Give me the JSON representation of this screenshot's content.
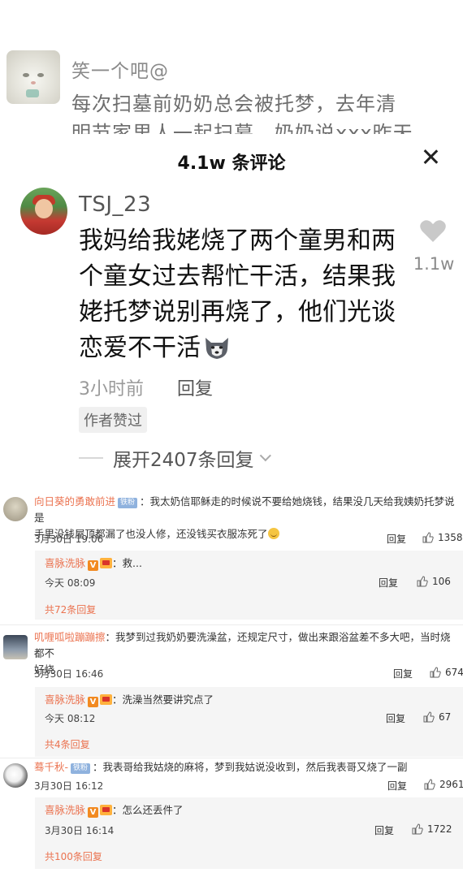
{
  "previous_comment": {
    "author": "笑一个吧@",
    "line1": "每次扫墓前奶奶总会被托梦，去年清",
    "line2": "明节家里人一起扫墓，奶奶说xxx昨天"
  },
  "panel": {
    "title": "4.1w 条评论",
    "comment": {
      "author": "TSJ_23",
      "lines": [
        "我妈给我姥烧了两个童男和两",
        "个童女过去帮忙干活，结果我",
        "姥托梦说别再烧了，他们光谈",
        "恋爱不干活"
      ],
      "emoji": "husky-icon",
      "likes": "1.1w",
      "time": "3小时前",
      "reply_label": "回复",
      "author_liked": "作者赞过",
      "expand_label": "展开2407条回复"
    }
  },
  "weibo": {
    "reply_label": "回复",
    "comments": [
      {
        "name": "向日葵的勇敢前进",
        "badge": "铁粉",
        "text_line1": "：我太奶信耶稣走的时候说不要给她烧钱，结果没几天给我姨奶托梦说是",
        "text_line2": "手里没钱屋顶都漏了也没人修，还没钱买衣服冻死了",
        "time": "3月30日 19:06",
        "likes": "1358",
        "reply": {
          "name": "喜脉洗脉",
          "text": "：救...",
          "time": "今天 08:09",
          "likes": "106"
        },
        "more": "共72条回复"
      },
      {
        "name": "叽喱呱啦蹦蹦擦",
        "badge": "",
        "text_line1": "：我梦到过我奶奶要洗澡盆，还规定尺寸，做出来跟浴盆差不多大吧，当时烧都不",
        "text_line2": "好烧",
        "time": "3月30日 16:46",
        "likes": "674",
        "reply": {
          "name": "喜脉洗脉",
          "text": "：洗澡当然要讲究点了",
          "time": "今天 08:12",
          "likes": "67"
        },
        "more": "共4条回复"
      },
      {
        "name": "蓦千秋-",
        "badge": "铁粉",
        "text_line1": "：我表哥给我姑烧的麻将，梦到我姑说没收到，然后我表哥又烧了一副",
        "text_line2": "",
        "time": "3月30日 16:12",
        "likes": "2961",
        "reply": {
          "name": "喜脉洗脉",
          "text": "：怎么还丢件了",
          "time": "3月30日 16:14",
          "likes": "1722"
        },
        "more": "共100条回复"
      }
    ]
  },
  "colors": {
    "accent": "#eb7350",
    "badge": "#8fb2de",
    "vip": "#f28a21"
  }
}
